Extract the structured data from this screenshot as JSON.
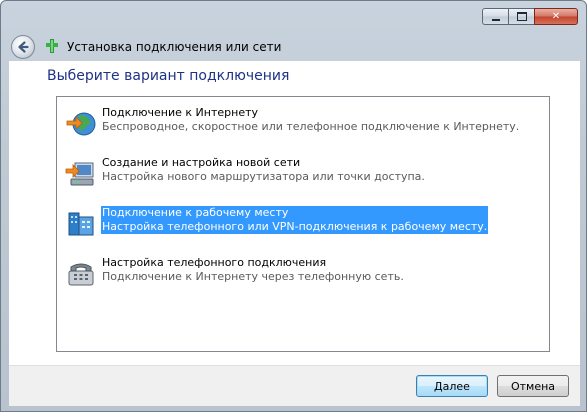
{
  "window": {
    "title": "Установка подключения или сети",
    "controls": [
      "minimize-icon",
      "maximize-icon",
      "close-icon"
    ],
    "close_glyph": "✕"
  },
  "nav": {
    "back_icon": "back-arrow-icon",
    "title_icon": "network-plug-icon",
    "title": "Установка подключения или сети"
  },
  "page": {
    "heading": "Выберите вариант подключения"
  },
  "options": [
    {
      "icon": "internet-globe-icon",
      "title": "Подключение к Интернету",
      "description": "Беспроводное, скоростное или телефонное подключение к Интернету.",
      "selected": false
    },
    {
      "icon": "new-network-icon",
      "title": "Создание и настройка новой сети",
      "description": "Настройка нового маршрутизатора или точки доступа.",
      "selected": false
    },
    {
      "icon": "workplace-icon",
      "title": "Подключение к рабочему месту",
      "description": "Настройка телефонного или VPN-подключения к рабочему месту.",
      "selected": true
    },
    {
      "icon": "telephone-modem-icon",
      "title": "Настройка телефонного подключения",
      "description": "Подключение к Интернету через телефонную сеть.",
      "selected": false
    }
  ],
  "buttons": {
    "next_label": "Далее",
    "cancel_label": "Отмена"
  },
  "colors": {
    "heading": "#1e3287",
    "selection": "#3399ff",
    "description_text": "#5a5a5a"
  }
}
